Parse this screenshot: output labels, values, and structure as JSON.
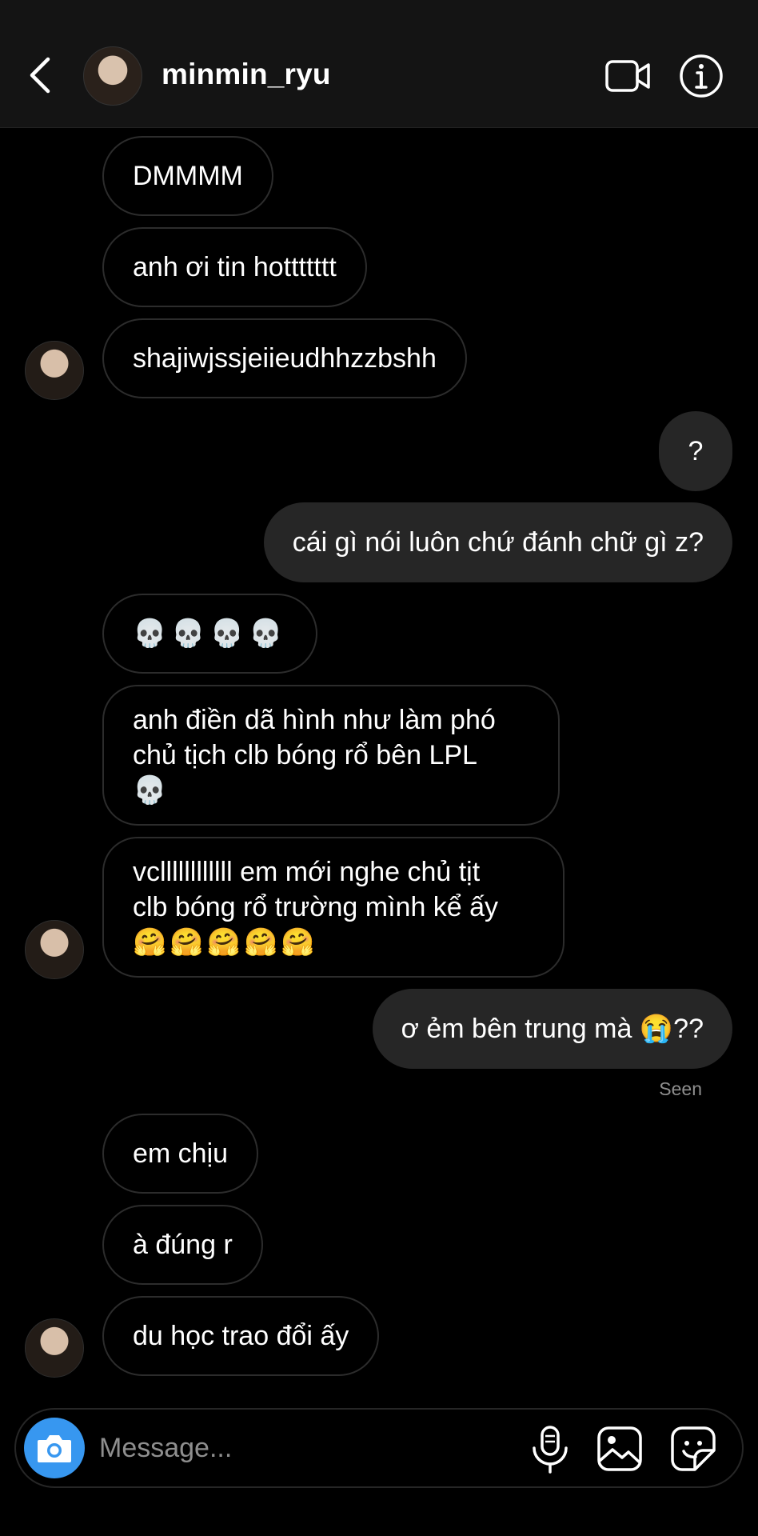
{
  "header": {
    "username": "minmin_ryu",
    "back_icon": "chevron-left-icon",
    "video_icon": "video-camera-icon",
    "info_icon": "info-icon"
  },
  "messages": [
    {
      "side": "in",
      "text": "DMMMM"
    },
    {
      "side": "in",
      "text": "anh ơi tin hottttttt"
    },
    {
      "side": "in",
      "text": "shajiwjssjeiieudhhzzbshh"
    },
    {
      "side": "out",
      "text": "?"
    },
    {
      "side": "out",
      "text": "cái gì nói luôn chứ đánh chữ gì z?"
    },
    {
      "side": "in",
      "text": "💀💀💀💀"
    },
    {
      "side": "in",
      "lines": [
        "anh điền dã hình như làm phó",
        "chủ tịch clb bóng rổ bên LPL",
        "💀"
      ]
    },
    {
      "side": "in",
      "lines": [
        "vcllllllllllll em mới nghe chủ tịt",
        "clb bóng rổ trường mình kể ấy",
        "🤗🤗🤗🤗🤗"
      ]
    },
    {
      "side": "out",
      "text": "ơ ẻm bên trung mà 😭??"
    },
    {
      "side": "in",
      "text": "em chịu"
    },
    {
      "side": "in",
      "text": "à đúng r"
    },
    {
      "side": "in",
      "text": "du học trao đổi ấy"
    }
  ],
  "seen_label": "Seen",
  "composer": {
    "placeholder": "Message...",
    "camera_icon": "camera-icon",
    "mic_icon": "microphone-icon",
    "gallery_icon": "gallery-icon",
    "sticker_icon": "sticker-icon"
  },
  "colors": {
    "background": "#000000",
    "header_bg": "#141414",
    "outgoing_bubble": "#262626",
    "incoming_border": "#2c2c2c",
    "camera_button": "#3797f0",
    "muted_text": "#8e8e8e"
  }
}
